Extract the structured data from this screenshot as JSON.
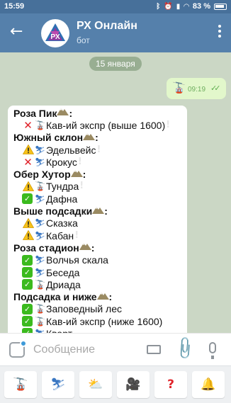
{
  "status_bar": {
    "time": "15:59",
    "battery": "83 %",
    "icons": [
      "bluetooth-icon",
      "alarm-icon",
      "sim-icon",
      "wifi-icon"
    ]
  },
  "header": {
    "title": "РХ Онлайн",
    "subtitle": "бот"
  },
  "chat": {
    "date_divider": "15 января",
    "outgoing": {
      "emoji": "🚡",
      "time": "09:19"
    },
    "message_lines": [
      {
        "type": "head",
        "text": "Роза Пик",
        "icon": "mountain-icon"
      },
      {
        "type": "item",
        "status": "closed",
        "kind": "lift",
        "text": "Кав-ий экспр (выше 1600)",
        "mark": "!"
      },
      {
        "type": "head",
        "text": "Южный склон",
        "icon": "mountain-icon"
      },
      {
        "type": "item",
        "status": "warning",
        "kind": "ski",
        "text": "Эдельвейс",
        "mark": "!"
      },
      {
        "type": "item",
        "status": "closed",
        "kind": "ski",
        "text": "Крокус",
        "mark": "!"
      },
      {
        "type": "head",
        "text": "Обер Хутор",
        "icon": "mountain-icon"
      },
      {
        "type": "item",
        "status": "warning",
        "kind": "lift",
        "text": "Тундра",
        "mark": "!"
      },
      {
        "type": "item",
        "status": "open",
        "kind": "ski",
        "text": "Дафна",
        "mark": ""
      },
      {
        "type": "head",
        "text": "Выше подсадки",
        "icon": "mountain-icon"
      },
      {
        "type": "item",
        "status": "warning",
        "kind": "ski",
        "text": "Сказка",
        "mark": ""
      },
      {
        "type": "item",
        "status": "warning",
        "kind": "ski",
        "text": "Кабан",
        "mark": "!"
      },
      {
        "type": "head",
        "text": "Роза стадион",
        "icon": "mountain-icon"
      },
      {
        "type": "item",
        "status": "open",
        "kind": "ski",
        "text": "Волчья скала",
        "mark": ""
      },
      {
        "type": "item",
        "status": "open",
        "kind": "ski",
        "text": "Беседа",
        "mark": ""
      },
      {
        "type": "item",
        "status": "open",
        "kind": "lift",
        "text": "Дриада",
        "mark": ""
      },
      {
        "type": "head",
        "text": "Подсадка и ниже",
        "icon": "mountain-icon"
      },
      {
        "type": "item",
        "status": "open",
        "kind": "lift",
        "text": "Заповедный лес",
        "mark": ""
      },
      {
        "type": "item",
        "status": "open",
        "kind": "lift",
        "text": "Кав-ий экспр (ниже 1600)",
        "mark": ""
      },
      {
        "type": "item",
        "status": "open",
        "kind": "ski",
        "text": "Кварт",
        "mark": ""
      }
    ]
  },
  "composer": {
    "placeholder": "Сообщение"
  },
  "bot_keyboard": [
    {
      "name": "lifts",
      "glyph": "🚡"
    },
    {
      "name": "skier",
      "glyph": "⛷"
    },
    {
      "name": "weather",
      "glyph": "⛅"
    },
    {
      "name": "camera",
      "glyph": "🎥"
    },
    {
      "name": "help",
      "glyph": "?"
    },
    {
      "name": "notifications",
      "glyph": "🔔"
    }
  ]
}
